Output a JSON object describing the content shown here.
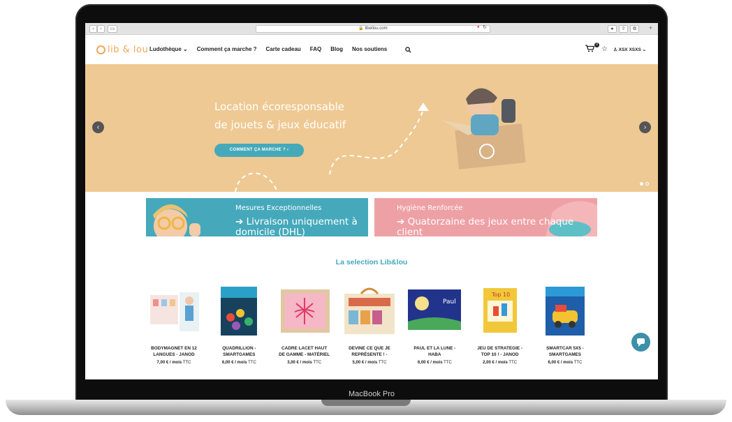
{
  "device": {
    "label": "MacBook Pro"
  },
  "browser": {
    "url": "libetlou.com"
  },
  "nav": {
    "logo_text": "lib & lou",
    "items": [
      "Ludothèque",
      "Comment ça marche ?",
      "Carte cadeau",
      "FAQ",
      "Blog",
      "Nos soutiens"
    ],
    "cart_count": "0",
    "account_label": "XSX XSXS"
  },
  "hero": {
    "title_line1": "Location écoresponsable",
    "title_line2": "de jouets & jeux éducatif",
    "cta_label": "COMMENT ÇA MARCHE ?"
  },
  "banners": [
    {
      "title": "Mesures Exceptionnelles",
      "text_line1": "➔ Livraison uniquement à",
      "text_line2": "domicile (DHL)"
    },
    {
      "title": "Hygiène Renforcée",
      "text_line1": "➔ Quatorzaine des jeux entre chaque",
      "text_line2": "client"
    }
  ],
  "selection": {
    "title": "La selection Lib&lou",
    "products": [
      {
        "name_line1": "BODYMAGNET EN 12",
        "name_line2": "LANGUES - JANOD",
        "price": "7,00 € / mois",
        "tax": "TTC"
      },
      {
        "name_line1": "QUADRILLION -",
        "name_line2": "SMARTGAMES",
        "price": "6,00 € / mois",
        "tax": "TTC"
      },
      {
        "name_line1": "CADRE LACET HAUT",
        "name_line2": "DE GAMME - MATÉRIEL",
        "price": "3,00 € / mois",
        "tax": "TTC"
      },
      {
        "name_line1": "DEVINE CE QUE JE",
        "name_line2": "REPRÉSENTE ! -",
        "price": "5,00 € / mois",
        "tax": "TTC"
      },
      {
        "name_line1": "PAUL ET LA LUNE -",
        "name_line2": "HABA",
        "price": "6,00 € / mois",
        "tax": "TTC"
      },
      {
        "name_line1": "JEU DE STRATEGIE -",
        "name_line2": "TOP 10 ! - JANOD",
        "price": "2,00 € / mois",
        "tax": "TTC"
      },
      {
        "name_line1": "SMARTCAR 5X5 -",
        "name_line2": "SMARTGAMES",
        "price": "6,00 € / mois",
        "tax": "TTC"
      }
    ]
  }
}
